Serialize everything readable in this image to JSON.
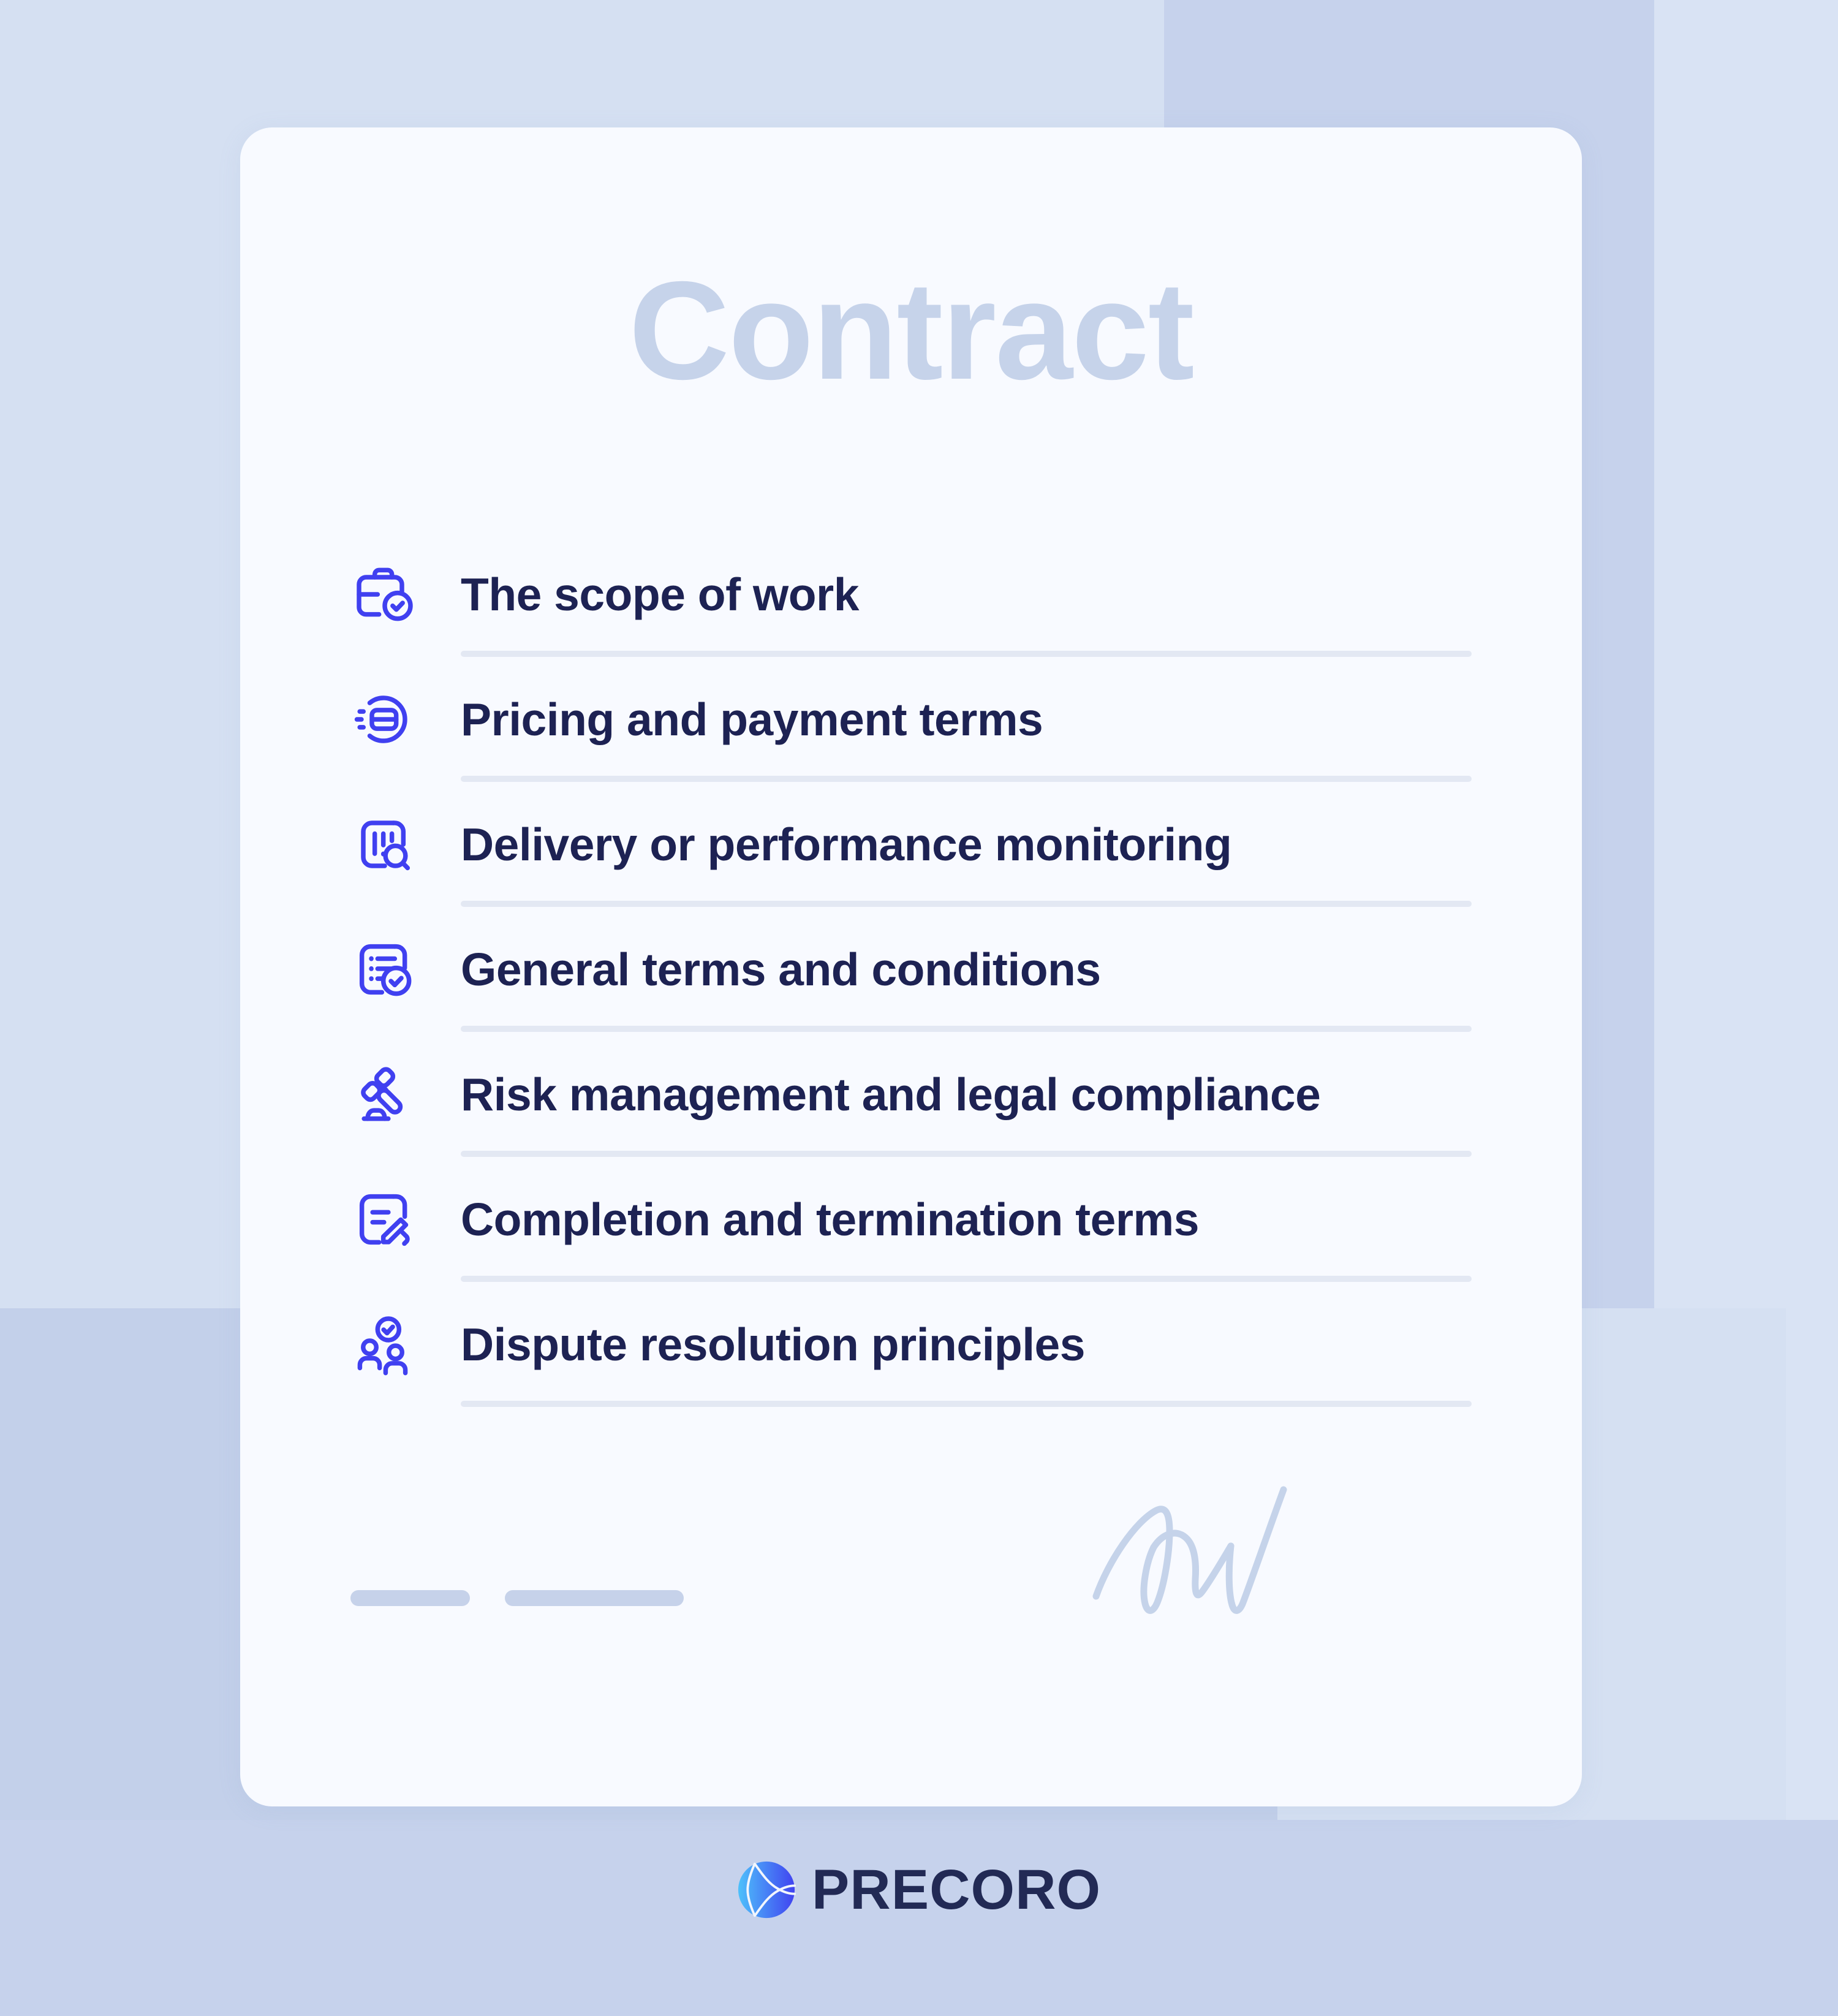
{
  "card": {
    "title": "Contract",
    "items": [
      {
        "icon": "briefcase-check-icon",
        "label": "The scope of work"
      },
      {
        "icon": "payment-card-circle-icon",
        "label": "Pricing and payment terms"
      },
      {
        "icon": "chart-search-icon",
        "label": "Delivery or performance monitoring"
      },
      {
        "icon": "document-list-check-icon",
        "label": "General terms and conditions"
      },
      {
        "icon": "gavel-icon",
        "label": "Risk management and legal compliance"
      },
      {
        "icon": "document-edit-icon",
        "label": "Completion and termination terms"
      },
      {
        "icon": "users-check-icon",
        "label": "Dispute resolution principles"
      }
    ],
    "signature_area": {
      "placeholder_bar_1": "",
      "placeholder_bar_2": "",
      "signature_icon": "handwritten-signature-icon"
    }
  },
  "footer": {
    "logo_mark": "precoro-logo-mark",
    "brand_name": "PRECORO"
  },
  "colors": {
    "page_background": "#d5e0f2",
    "background_band_dark": "#c3d0ea",
    "background_band_light": "#d9e3f4",
    "card_background": "#f8faff",
    "title_text": "#c6d3ea",
    "item_text": "#1d2253",
    "icon_accent": "#4040f0",
    "divider": "#e3e8f3",
    "placeholder_bar": "#c6d2ea",
    "signature_stroke": "#c5d3ea",
    "brand_text": "#222a55",
    "logo_gradient_start": "#4ec3fb",
    "logo_gradient_end": "#4040f0"
  }
}
